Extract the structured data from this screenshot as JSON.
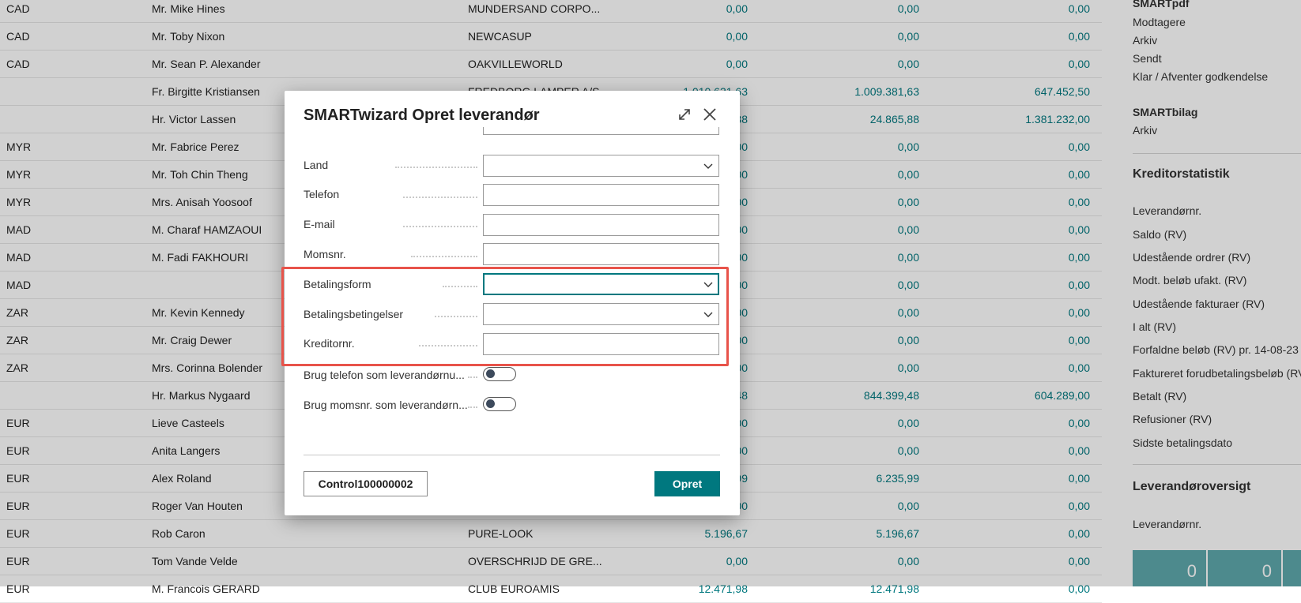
{
  "rows": [
    {
      "currency": "CAD",
      "contact": "Mr. Mike Hines",
      "company": "MUNDERSAND CORPO...",
      "v1": "0,00",
      "v2": "0,00",
      "v3": "0,00"
    },
    {
      "currency": "CAD",
      "contact": "Mr. Toby Nixon",
      "company": "NEWCASUP",
      "v1": "0,00",
      "v2": "0,00",
      "v3": "0,00"
    },
    {
      "currency": "CAD",
      "contact": "Mr. Sean P. Alexander",
      "company": "OAKVILLEWORLD",
      "v1": "0,00",
      "v2": "0,00",
      "v3": "0,00"
    },
    {
      "currency": "",
      "contact": "Fr. Birgitte Kristiansen",
      "company": "FREDBORG LAMPER A/S",
      "v1": "1.010.631,63",
      "v2": "1.009.381,63",
      "v3": "647.452,50"
    },
    {
      "currency": "",
      "contact": "Hr. Victor Lassen",
      "company": "",
      "v1": "38",
      "v2": "24.865,88",
      "v3": "1.381.232,00"
    },
    {
      "currency": "MYR",
      "contact": "Mr. Fabrice Perez",
      "company": "",
      "v1": "00",
      "v2": "0,00",
      "v3": "0,00"
    },
    {
      "currency": "MYR",
      "contact": "Mr. Toh Chin Theng",
      "company": "",
      "v1": "00",
      "v2": "0,00",
      "v3": "0,00"
    },
    {
      "currency": "MYR",
      "contact": "Mrs. Anisah Yoosoof",
      "company": "",
      "v1": "00",
      "v2": "0,00",
      "v3": "0,00"
    },
    {
      "currency": "MAD",
      "contact": "M. Charaf HAMZAOUI",
      "company": "",
      "v1": "00",
      "v2": "0,00",
      "v3": "0,00"
    },
    {
      "currency": "MAD",
      "contact": "M. Fadi FAKHOURI",
      "company": "",
      "v1": "00",
      "v2": "0,00",
      "v3": "0,00"
    },
    {
      "currency": "MAD",
      "contact": "",
      "company": "",
      "v1": "00",
      "v2": "0,00",
      "v3": "0,00"
    },
    {
      "currency": "ZAR",
      "contact": "Mr. Kevin Kennedy",
      "company": "",
      "v1": "00",
      "v2": "0,00",
      "v3": "0,00"
    },
    {
      "currency": "ZAR",
      "contact": "Mr. Craig Dewer",
      "company": "",
      "v1": "00",
      "v2": "0,00",
      "v3": "0,00"
    },
    {
      "currency": "ZAR",
      "contact": "Mrs. Corinna Bolender",
      "company": "",
      "v1": "00",
      "v2": "0,00",
      "v3": "0,00"
    },
    {
      "currency": "",
      "contact": "Hr. Markus Nygaard",
      "company": "",
      "v1": "48",
      "v2": "844.399,48",
      "v3": "604.289,00"
    },
    {
      "currency": "EUR",
      "contact": "Lieve Casteels",
      "company": "",
      "v1": "00",
      "v2": "0,00",
      "v3": "0,00"
    },
    {
      "currency": "EUR",
      "contact": "Anita Langers",
      "company": "",
      "v1": "00",
      "v2": "0,00",
      "v3": "0,00"
    },
    {
      "currency": "EUR",
      "contact": "Alex Roland",
      "company": "",
      "v1": "99",
      "v2": "6.235,99",
      "v3": "0,00"
    },
    {
      "currency": "EUR",
      "contact": "Roger Van Houten",
      "company": "",
      "v1": "00",
      "v2": "0,00",
      "v3": "0,00"
    },
    {
      "currency": "EUR",
      "contact": "Rob Caron",
      "company": "PURE-LOOK",
      "v1": "5.196,67",
      "v2": "5.196,67",
      "v3": "0,00"
    },
    {
      "currency": "EUR",
      "contact": "Tom Vande Velde",
      "company": "OVERSCHRIJD DE GRE...",
      "v1": "0,00",
      "v2": "0,00",
      "v3": "0,00"
    },
    {
      "currency": "EUR",
      "contact": "M. Francois GERARD",
      "company": "CLUB EUROAMIS",
      "v1": "12.471,98",
      "v2": "12.471,98",
      "v3": "0,00"
    }
  ],
  "factbox": {
    "smartpdf": {
      "title": "SMARTpdf",
      "items": [
        "Modtagere",
        "Arkiv",
        "Sendt",
        "Klar / Afventer godkendelse"
      ]
    },
    "smartbilag": {
      "title": "SMARTbilag",
      "items": [
        "Arkiv"
      ]
    },
    "stats": {
      "title": "Kreditorstatistik",
      "items": [
        "Leverandørnr.",
        "Saldo (RV)",
        "Udestående ordrer (RV)",
        "Modt. beløb ufakt. (RV)",
        "Udestående fakturaer (RV)",
        "I alt (RV)",
        "Forfaldne beløb (RV) pr. 14-08-23",
        "Faktureret forudbetalingsbeløb (RV)",
        "Betalt (RV)",
        "Refusioner (RV)",
        "Sidste betalingsdato"
      ]
    },
    "overview": {
      "title": "Leverandøroversigt",
      "item": "Leverandørnr.",
      "tiles": [
        "0",
        "0"
      ]
    }
  },
  "dialog": {
    "title": "SMARTwizard Opret leverandør",
    "fields": [
      {
        "label": "Land",
        "type": "select",
        "value": ""
      },
      {
        "label": "Telefon",
        "type": "text",
        "value": ""
      },
      {
        "label": "E-mail",
        "type": "text",
        "value": ""
      },
      {
        "label": "Momsnr.",
        "type": "text",
        "value": ""
      },
      {
        "label": "Betalingsform",
        "type": "select",
        "value": ""
      },
      {
        "label": "Betalingsbetingelser",
        "type": "select",
        "value": ""
      },
      {
        "label": "Kreditornr.",
        "type": "text",
        "value": ""
      }
    ],
    "toggles": [
      {
        "label": "Brug telefon som leverandørnu...",
        "on": false
      },
      {
        "label": "Brug momsnr. som leverandørn...",
        "on": false
      }
    ],
    "secondary_button": "Control100000002",
    "primary_button": "Opret"
  },
  "colors": {
    "accent": "#00787f",
    "highlight": "#e8534a",
    "tile": "#5fa9ad"
  }
}
